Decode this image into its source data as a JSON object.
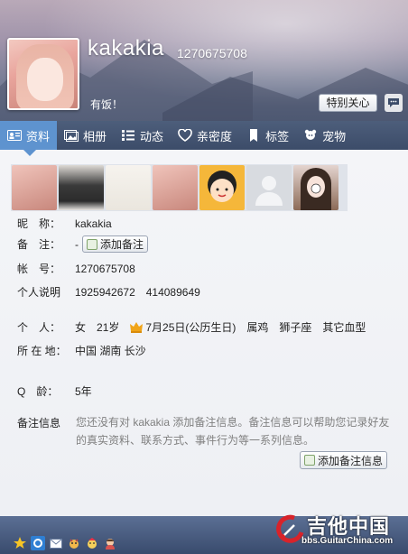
{
  "profile": {
    "nickname": "kakakia",
    "uin": "1270675708",
    "mood": "有饭！",
    "care_button": "特别关心"
  },
  "tabs": [
    {
      "label": "资料",
      "icon": "profile-card-icon"
    },
    {
      "label": "相册",
      "icon": "album-icon"
    },
    {
      "label": "动态",
      "icon": "feed-icon"
    },
    {
      "label": "亲密度",
      "icon": "heart-icon"
    },
    {
      "label": "标签",
      "icon": "bookmark-icon"
    },
    {
      "label": "宠物",
      "icon": "pet-icon"
    }
  ],
  "fields": {
    "nickname_label": "昵　称：",
    "nickname_value": "kakakia",
    "remark_label": "备　注：",
    "remark_value": "-",
    "add_remark": "添加备注",
    "account_label": "帐　号：",
    "account_value": "1270675708",
    "desc_label": "个人说明",
    "desc_value": "1925942672　414089649",
    "personal_label": "个　人：",
    "personal_items": [
      "女",
      "21岁",
      "7月25日(公历生日)",
      "属鸡",
      "狮子座",
      "其它血型"
    ],
    "location_label": "所 在 地：",
    "location_value": "中国 湖南 长沙",
    "qage_label": "Q　龄：",
    "qage_value": "5年",
    "note_label": "备注信息",
    "note_text": "您还没有对 kakakia 添加备注信息。备注信息可以帮助您记录好友的真实资料、联系方式、事件行为等一系列信息。",
    "add_note": "添加备注信息"
  },
  "watermark": {
    "main": "吉他中国",
    "sub": "bbs.GuitarChina.com"
  },
  "colors": {
    "tab_active": "#5e93cf",
    "tab_bar": "#44546f",
    "crown": "#f0a418"
  }
}
